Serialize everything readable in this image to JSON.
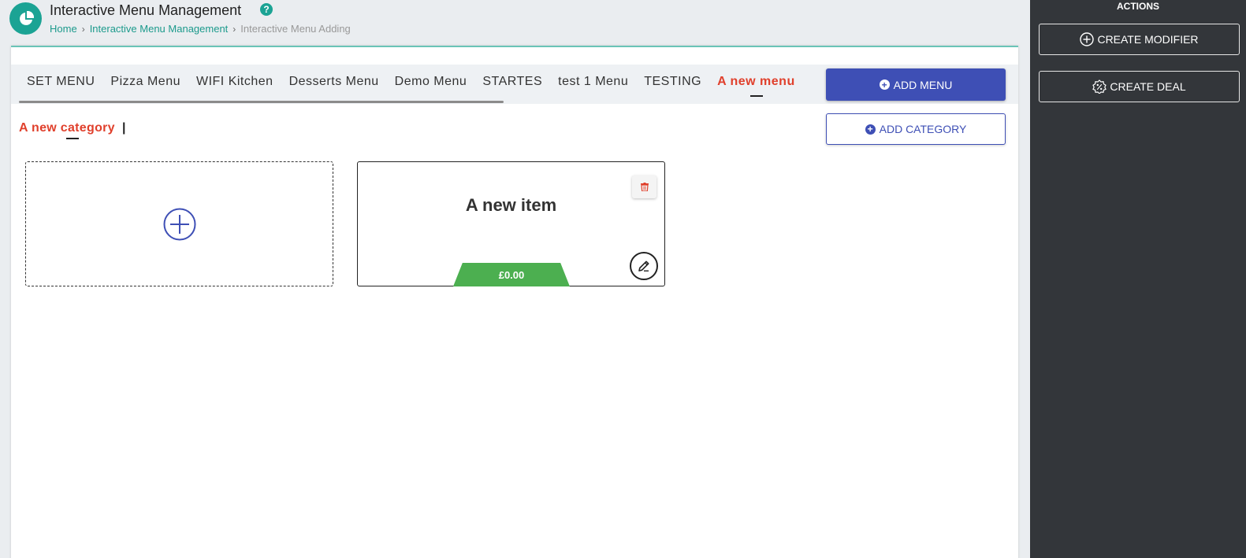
{
  "header": {
    "title": "Interactive Menu Management",
    "help_icon": "question-circle-icon",
    "breadcrumb": {
      "home": "Home",
      "section": "Interactive Menu Management",
      "current": "Interactive Menu Adding"
    }
  },
  "menu_tabs": [
    {
      "label": "SET MENU",
      "active": false
    },
    {
      "label": "Pizza Menu",
      "active": false
    },
    {
      "label": "WIFI Kitchen",
      "active": false
    },
    {
      "label": "Desserts Menu",
      "active": false
    },
    {
      "label": "Demo Menu",
      "active": false
    },
    {
      "label": "STARTES",
      "active": false
    },
    {
      "label": "test 1 Menu",
      "active": false
    },
    {
      "label": "TESTING",
      "active": false
    },
    {
      "label": "A new menu",
      "active": true
    }
  ],
  "buttons": {
    "add_menu": "ADD MENU",
    "add_category": "ADD CATEGORY"
  },
  "category": {
    "title": "A new category",
    "cursor": "|"
  },
  "items": [
    {
      "name": "A new item",
      "price": "£0.00"
    }
  ],
  "right_panel": {
    "title": "ACTIONS",
    "create_modifier": "CREATE MODIFIER",
    "create_deal": "CREATE DEAL"
  },
  "colors": {
    "brand_teal": "#1ba394",
    "primary_blue": "#3e4fb5",
    "active_red": "#e0402c",
    "price_green": "#4caf50",
    "panel_dark": "#33363a"
  }
}
